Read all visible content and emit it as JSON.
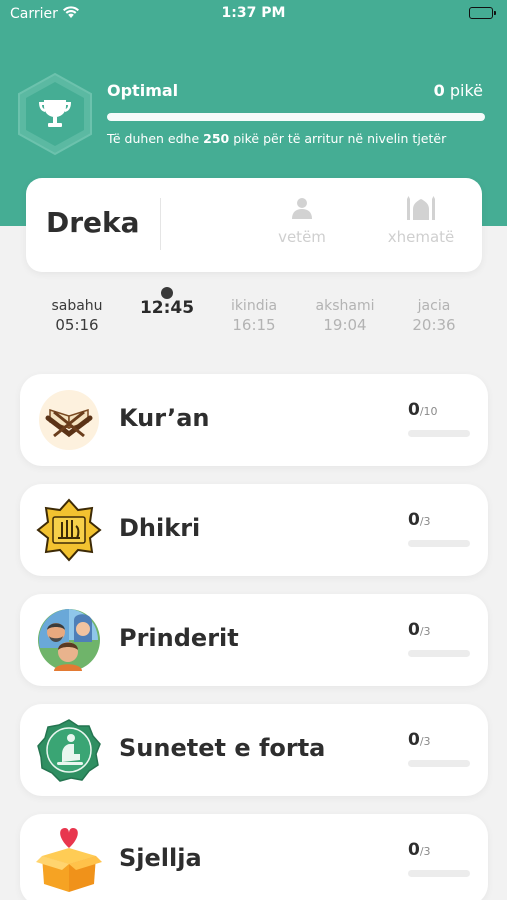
{
  "status_bar": {
    "carrier": "Carrier",
    "time": "1:37 PM"
  },
  "level": {
    "name": "Optimal",
    "points_value": "0",
    "points_unit": "pikë",
    "progress": 0,
    "hint_prefix": "Të duhen edhe",
    "hint_points": "250",
    "hint_suffix": "pikë për të arritur në nivelin tjetër",
    "badge_icon": "trophy-icon"
  },
  "prayer_card": {
    "name": "Dreka",
    "modes": [
      {
        "label": "vetëm",
        "icon": "person-icon"
      },
      {
        "label": "xhematë",
        "icon": "mosque-icon"
      }
    ]
  },
  "prayer_times": [
    {
      "name": "sabahu",
      "time": "05:16",
      "state": "past"
    },
    {
      "name": "",
      "time": "12:45",
      "state": "current"
    },
    {
      "name": "ikindia",
      "time": "16:15",
      "state": "future"
    },
    {
      "name": "akshami",
      "time": "19:04",
      "state": "future"
    },
    {
      "name": "jacia",
      "time": "20:36",
      "state": "future"
    }
  ],
  "activities": [
    {
      "title": "Kur’an",
      "score": "0",
      "max": "/10",
      "progress": 0,
      "icon": "quran-icon"
    },
    {
      "title": "Dhikri",
      "score": "0",
      "max": "/3",
      "progress": 0,
      "icon": "allah-calligraphy-icon"
    },
    {
      "title": "Prinderit",
      "score": "0",
      "max": "/3",
      "progress": 0,
      "icon": "parents-icon"
    },
    {
      "title": "Sunetet e forta",
      "score": "0",
      "max": "/3",
      "progress": 0,
      "icon": "praying-person-icon"
    },
    {
      "title": "Sjellja",
      "score": "0",
      "max": "/3",
      "progress": 0,
      "icon": "gift-box-heart-icon"
    }
  ],
  "colors": {
    "primary": "#45ad94",
    "background": "#f2f2f2",
    "card": "#ffffff",
    "accent_gold": "#e9c542"
  }
}
